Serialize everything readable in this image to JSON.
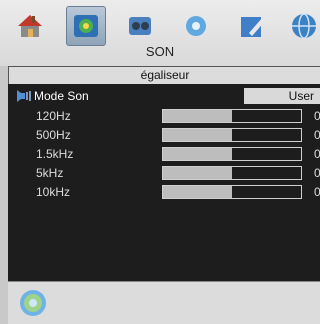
{
  "menu": {
    "title": "SON"
  },
  "toolbar": {
    "items": [
      {
        "icon": "home-icon"
      },
      {
        "icon": "picture-icon",
        "selected": true
      },
      {
        "icon": "sound-icon"
      },
      {
        "icon": "settings-icon"
      },
      {
        "icon": "edit-icon"
      },
      {
        "icon": "globe-icon"
      }
    ]
  },
  "submenu": {
    "title": "égaliseur"
  },
  "mode": {
    "label": "Mode Son",
    "value": "User"
  },
  "bands": [
    {
      "label": "120Hz",
      "value": "0",
      "level": 0.5
    },
    {
      "label": "500Hz",
      "value": "0",
      "level": 0.5
    },
    {
      "label": "1.5kHz",
      "value": "0",
      "level": 0.5
    },
    {
      "label": "5kHz",
      "value": "0",
      "level": 0.5
    },
    {
      "label": "10kHz",
      "value": "0",
      "level": 0.5
    }
  ],
  "colors": {
    "panel": "#1d1d1d",
    "slider_fill": "#bdbdbd",
    "header_bg": "#dcdcdc"
  }
}
